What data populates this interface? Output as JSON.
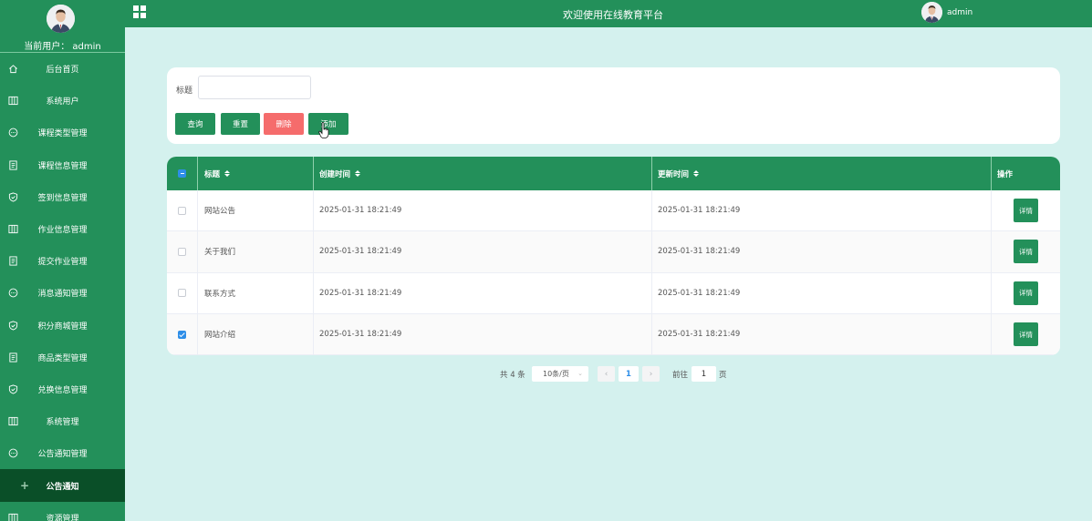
{
  "sidebar": {
    "current_user": "当前用户： admin",
    "items": [
      {
        "label": "后台首页",
        "icon": "home-icon"
      },
      {
        "label": "系统用户",
        "icon": "columns-icon"
      },
      {
        "label": "课程类型管理",
        "icon": "chat-icon"
      },
      {
        "label": "课程信息管理",
        "icon": "document-icon"
      },
      {
        "label": "签到信息管理",
        "icon": "shield-check-icon"
      },
      {
        "label": "作业信息管理",
        "icon": "columns-icon"
      },
      {
        "label": "提交作业管理",
        "icon": "document-icon"
      },
      {
        "label": "消息通知管理",
        "icon": "chat-icon"
      },
      {
        "label": "积分商城管理",
        "icon": "shield-check-icon"
      },
      {
        "label": "商品类型管理",
        "icon": "document-icon"
      },
      {
        "label": "兑换信息管理",
        "icon": "shield-check-icon"
      },
      {
        "label": "系统管理",
        "icon": "columns-icon"
      },
      {
        "label": "公告通知管理",
        "icon": "chat-icon"
      },
      {
        "label": "公告通知",
        "icon": "plus-icon",
        "active": true
      },
      {
        "label": "资源管理",
        "icon": "columns-icon"
      }
    ]
  },
  "header": {
    "title": "欢迎使用在线教育平台",
    "username": "admin"
  },
  "search": {
    "label": "标题",
    "value": "",
    "placeholder": "",
    "buttons": {
      "query": "查询",
      "reset": "重置",
      "delete": "删除",
      "add": "添加"
    }
  },
  "table": {
    "columns": {
      "title": "标题",
      "created": "创建时间",
      "updated": "更新时间",
      "action": "操作"
    },
    "detail_label": "详情",
    "rows": [
      {
        "title": "网站公告",
        "created": "2025-01-31 18:21:49",
        "updated": "2025-01-31 18:21:49",
        "checked": false
      },
      {
        "title": "关于我们",
        "created": "2025-01-31 18:21:49",
        "updated": "2025-01-31 18:21:49",
        "checked": false
      },
      {
        "title": "联系方式",
        "created": "2025-01-31 18:21:49",
        "updated": "2025-01-31 18:21:49",
        "checked": false
      },
      {
        "title": "网站介绍",
        "created": "2025-01-31 18:21:49",
        "updated": "2025-01-31 18:21:49",
        "checked": true
      }
    ]
  },
  "pagination": {
    "total": "共 4 条",
    "page_size": "10条/页",
    "current_page": "1",
    "goto_label": "前往",
    "jump_value": "1",
    "page_suffix": "页"
  },
  "colors": {
    "primary_green": "#23905a",
    "active_menu": "#0a4f28",
    "danger": "#f56c6c",
    "accent_blue": "#2e8ee8",
    "background": "#d4f1ee"
  }
}
